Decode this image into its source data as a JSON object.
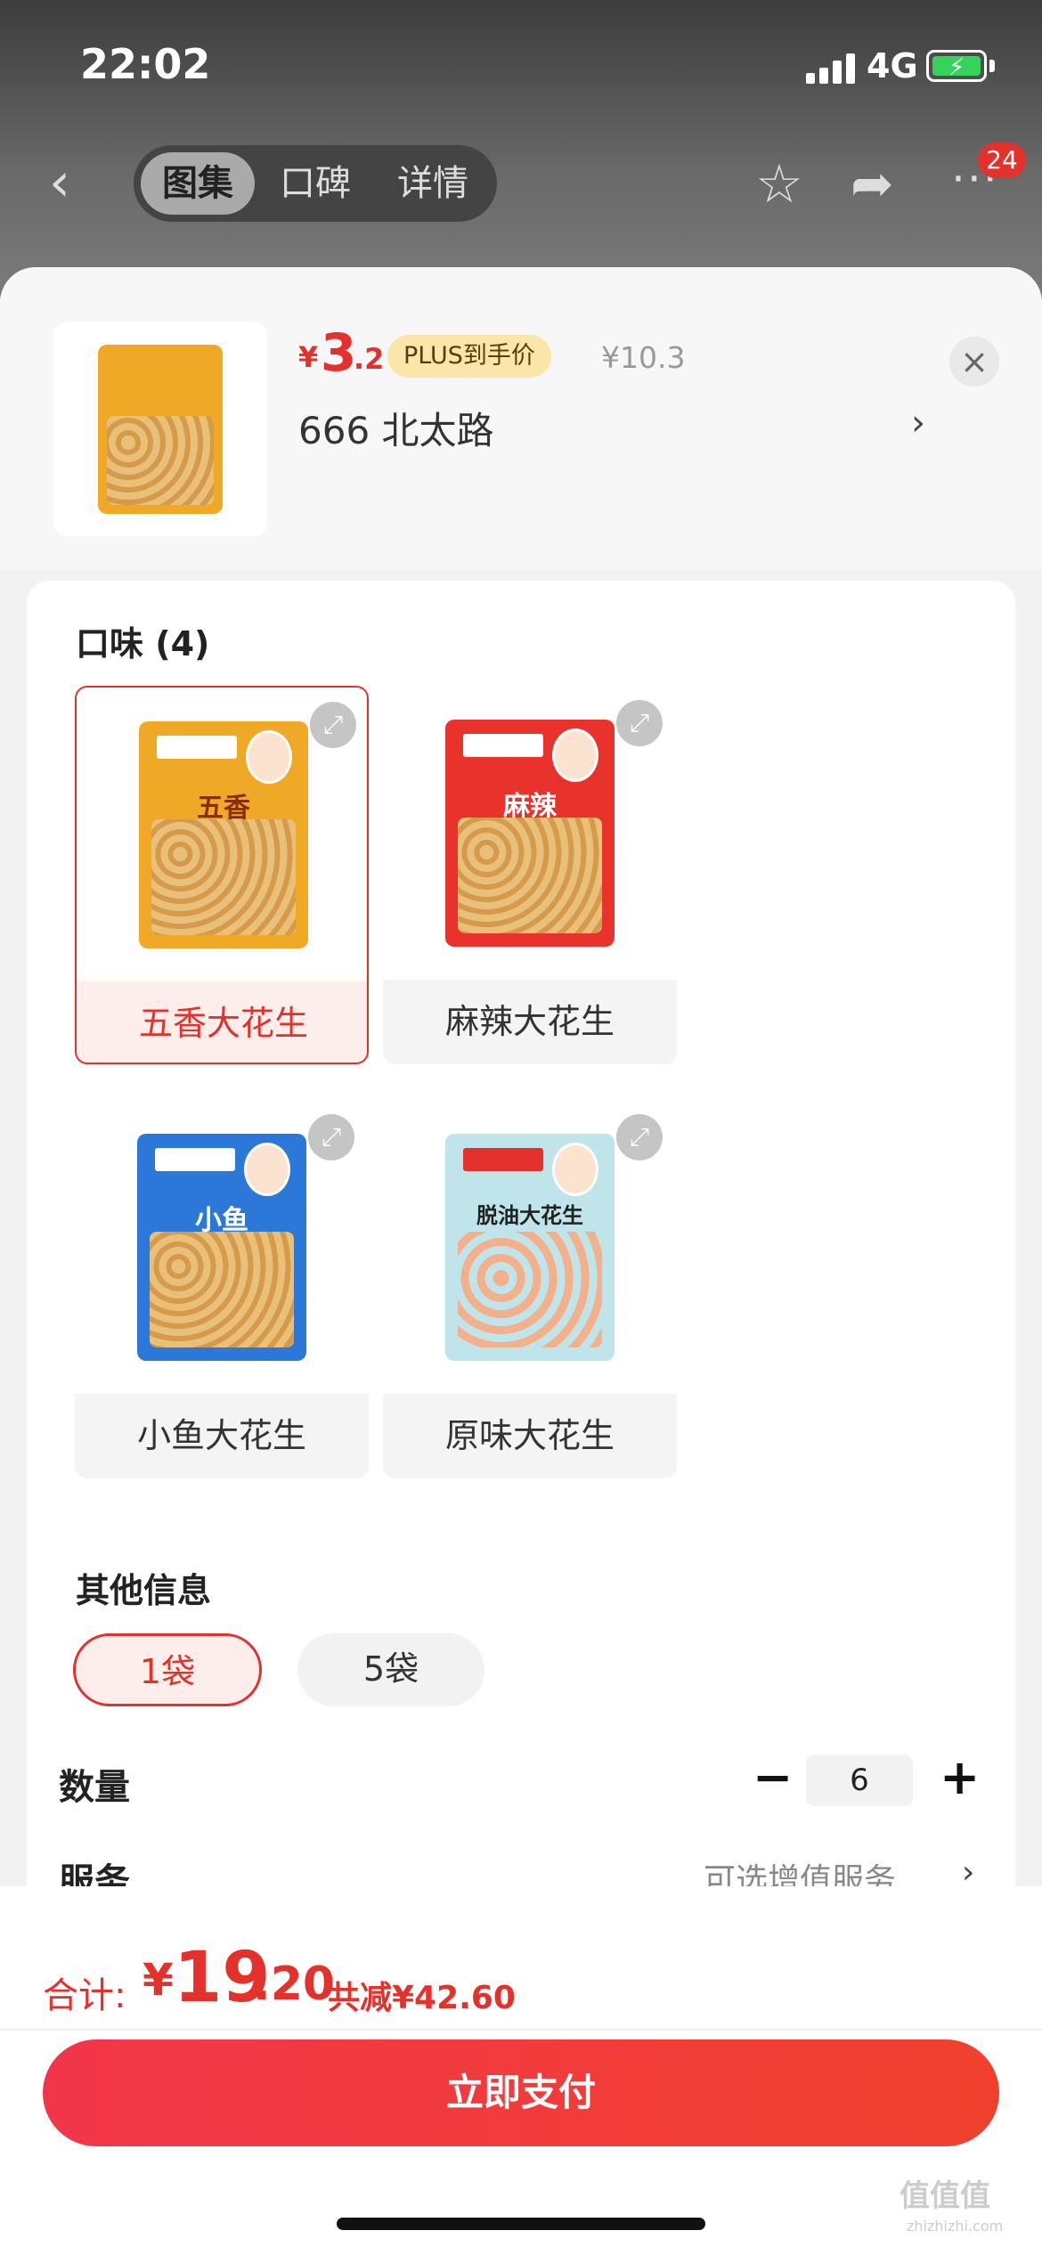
{
  "status_bar": {
    "time": "22:02",
    "network": "4G"
  },
  "nav": {
    "tabs": [
      {
        "label": "图集",
        "active": true
      },
      {
        "label": "口碑",
        "active": false
      },
      {
        "label": "详情",
        "active": false
      }
    ],
    "badge_count": "24",
    "icons": [
      "back-icon",
      "star-icon",
      "share-icon",
      "more-icon"
    ]
  },
  "product": {
    "price_symbol": "¥",
    "price_int": "3",
    "price_dec": ".2",
    "plus_tag": "PLUS到手价",
    "original_price": "¥10.3",
    "address": "666  北太路",
    "address_chevron": "›",
    "close": "×"
  },
  "flavor": {
    "title": "口味 (4)",
    "items": [
      {
        "label": "五香大花生",
        "selected": true,
        "pack_text": "五香",
        "pack_color": "#f0a927"
      },
      {
        "label": "麻辣大花生",
        "selected": false,
        "pack_text": "麻辣",
        "pack_color": "#e8322b"
      },
      {
        "label": "小鱼大花生",
        "selected": false,
        "pack_text": "小鱼",
        "pack_color": "#2c78d8"
      },
      {
        "label": "原味大花生",
        "selected": false,
        "pack_text": "脱油大花生",
        "pack_color": "#bfe4ea"
      }
    ]
  },
  "other_info": {
    "title": "其他信息",
    "options": [
      {
        "label": "1袋",
        "active": true
      },
      {
        "label": "5袋",
        "active": false
      }
    ]
  },
  "quantity": {
    "label": "数量",
    "value": "6",
    "minus": "−",
    "plus": "+"
  },
  "service": {
    "label": "服务",
    "value": "可选增值服务",
    "chevron": "›"
  },
  "footer": {
    "total_label": "合计:",
    "total_symbol": "¥",
    "total_int": "19",
    "total_dec": ".20",
    "saved": "共减¥42.60",
    "pay_button": "立即支付",
    "watermark": "值值值",
    "watermark_sub": "zhizhizhi.com"
  },
  "colors": {
    "accent": "#e4312b",
    "plus_tag_bg": "#fbe6a9"
  }
}
